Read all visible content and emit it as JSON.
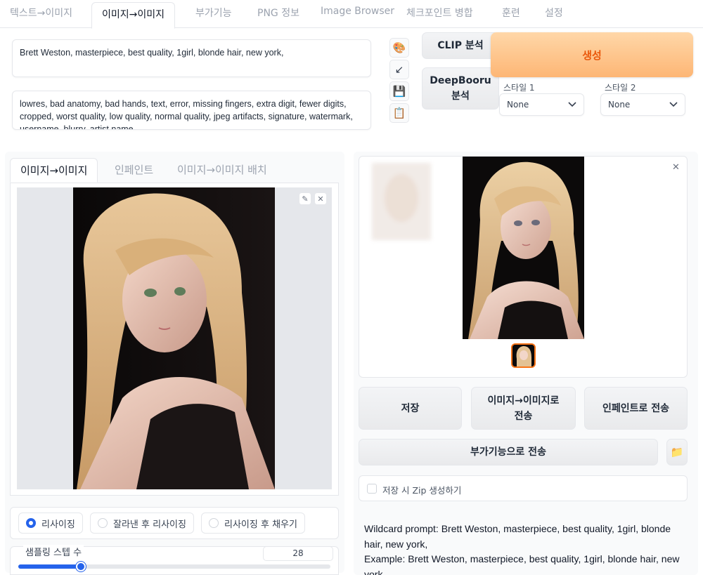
{
  "tabs": [
    {
      "label": "텍스트→이미지"
    },
    {
      "label": "이미지→이미지"
    },
    {
      "label": "부가기능"
    },
    {
      "label": "PNG 정보"
    },
    {
      "label": "Image Browser"
    },
    {
      "label": "체크포인트 병합"
    },
    {
      "label": "훈련"
    },
    {
      "label": "설정"
    }
  ],
  "prompt": {
    "positive": "Brett Weston, masterpiece, best quality, 1girl, blonde hair, new york,",
    "negative": "lowres, bad anatomy, bad hands, text, error, missing fingers, extra digit, fewer digits, cropped, worst quality, low quality, normal quality, jpeg artifacts, signature, watermark, username, blurry, artist name"
  },
  "tools": {
    "paint": "🎨",
    "arrow": "↙",
    "save": "💾",
    "clipboard": "📋"
  },
  "buttons": {
    "clip": "CLIP 분석",
    "deepbooru": "DeepBooru\n분석",
    "generate": "생성"
  },
  "styles": {
    "style1_label": "스타일 1",
    "style1_value": "None",
    "style2_label": "스타일 2",
    "style2_value": "None"
  },
  "subtabs": [
    {
      "label": "이미지→이미지"
    },
    {
      "label": "인페인트"
    },
    {
      "label": "이미지→이미지 배치"
    }
  ],
  "resize_options": [
    {
      "label": "리사이징",
      "selected": true
    },
    {
      "label": "잘라낸 후 리사이징",
      "selected": false
    },
    {
      "label": "리사이징 후 채우기",
      "selected": false
    }
  ],
  "sampling": {
    "label": "샘플링 스텝 수",
    "value": "28",
    "fraction": 0.2
  },
  "output_buttons": {
    "save": "저장",
    "send_img2img": "이미지→이미지로\n전송",
    "send_inpaint": "인페인트로 전송",
    "send_extras": "부가기능으로 전송"
  },
  "zip_checkbox": {
    "label": "저장 시 Zip 생성하기",
    "checked": false
  },
  "info_text": "Wildcard prompt: Brett Weston, masterpiece, best quality, 1girl, blonde hair, new york,\nExample: Brett Weston, masterpiece, best quality, 1girl, blonde hair, new york,",
  "colors": {
    "accent": "#2563eb",
    "generate_text": "#ea580c",
    "generate_bg": "#fdb675",
    "selected_thumb": "#f97316"
  }
}
